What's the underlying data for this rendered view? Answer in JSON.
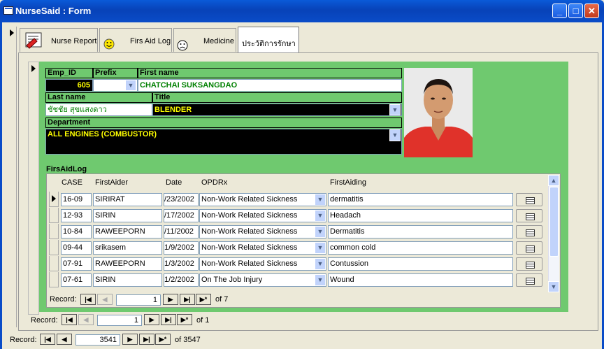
{
  "window": {
    "title": "NurseSaid : Form"
  },
  "tabs": [
    {
      "label": "Nurse Report",
      "icon": "report-icon"
    },
    {
      "label": "Firs Aid Log",
      "icon": "smiley-icon"
    },
    {
      "label": "Medicine",
      "icon": "frown-icon"
    },
    {
      "label": "ประวัติการรักษา",
      "icon": ""
    }
  ],
  "employee": {
    "labels": {
      "emp_id": "Emp_ID",
      "prefix": "Prefix",
      "first_name": "First name",
      "last_name": "Last name",
      "title": "Title",
      "department": "Department"
    },
    "emp_id": "605",
    "prefix": "",
    "first_name": "CHATCHAI SUKSANGDAO",
    "last_name": "ชัชชัย สุขแสงดาว",
    "title": "BLENDER",
    "department": "ALL ENGINES (COMBUSTOR)"
  },
  "firstaid": {
    "title": "FirsAidLog",
    "columns": [
      "CASE",
      "FirstAider",
      "Date",
      "OPDRx",
      "FirstAiding"
    ],
    "rows": [
      {
        "case": "16-09",
        "aider": "SIRIRAT",
        "date": "/23/2002",
        "opdrx": "Non-Work Related Sickness",
        "aiding": "dermatitis"
      },
      {
        "case": "12-93",
        "aider": "SIRIN",
        "date": "/17/2002",
        "opdrx": "Non-Work Related Sickness",
        "aiding": "Headach"
      },
      {
        "case": "10-84",
        "aider": "RAWEEPORN",
        "date": "/11/2002",
        "opdrx": "Non-Work Related Sickness",
        "aiding": "Dermatitis"
      },
      {
        "case": "09-44",
        "aider": "srikasem",
        "date": "1/9/2002",
        "opdrx": "Non-Work Related Sickness",
        "aiding": "common cold"
      },
      {
        "case": "07-91",
        "aider": "RAWEEPORN",
        "date": "1/3/2002",
        "opdrx": "Non-Work Related Sickness",
        "aiding": "Contussion"
      },
      {
        "case": "07-61",
        "aider": "SIRIN",
        "date": "1/2/2002",
        "opdrx": "On The Job Injury",
        "aiding": "Wound"
      }
    ],
    "nav": {
      "label": "Record:",
      "current": "1",
      "total": "of  7"
    }
  },
  "tab_nav": {
    "label": "Record:",
    "current": "1",
    "total": "of  1"
  },
  "form_nav": {
    "label": "Record:",
    "current": "3541",
    "total": "of  3547"
  }
}
